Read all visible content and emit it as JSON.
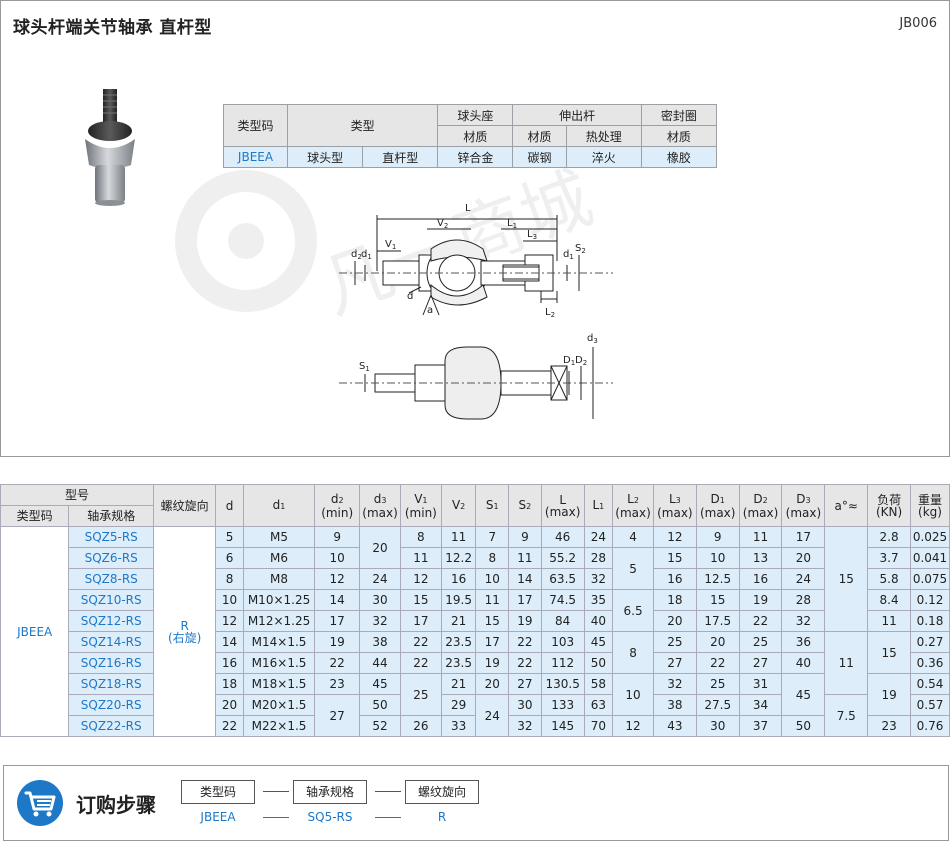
{
  "title": "球头杆端关节轴承  直杆型",
  "doc_code": "JB006",
  "spec": {
    "h_type_code": "类型码",
    "h_type": "类型",
    "h_ball_seat": "球头座",
    "h_rod": "伸出杆",
    "h_seal": "密封圈",
    "h_material": "材质",
    "h_heat": "热处理",
    "v_code": "JBEEA",
    "v_type1": "球头型",
    "v_type2": "直杆型",
    "v_seat": "锌合金",
    "v_rod": "碳钢",
    "v_heat": "淬火",
    "v_seal": "橡胶"
  },
  "drawing": {
    "L": "L",
    "L1": "L",
    "L3": "L",
    "L2": "L",
    "V1": "V",
    "V2": "V",
    "d2": "d",
    "d1": "d",
    "d": "d",
    "a": "a",
    "S2": "S",
    "S1": "S",
    "D1": "D",
    "D2": "D",
    "D3": "D",
    "d3": "d",
    "sub1": "1",
    "sub2": "2",
    "sub3": "3"
  },
  "table": {
    "h_model": "型号",
    "h_type_code": "类型码",
    "h_bearing": "轴承规格",
    "h_thread": "螺纹旋向",
    "h_d": "d",
    "h_d1": "d",
    "h_d2": "d",
    "h_d3": "d",
    "h_V1": "V",
    "h_V2": "V",
    "h_S1": "S",
    "h_S2": "S",
    "h_L": "L",
    "h_L1": "L",
    "h_L2": "L",
    "h_L3": "L",
    "h_D1": "D",
    "h_D2": "D",
    "h_D3": "D",
    "h_a": "a°≈",
    "h_load": "负荷",
    "h_load_unit": "(KN)",
    "h_weight": "重量",
    "h_weight_unit": "(kg)",
    "min": "(min)",
    "max": "(max)",
    "sub1": "1",
    "sub2": "2",
    "sub3": "3",
    "code": "JBEEA",
    "thread": "R",
    "thread_note": "(右旋)",
    "rows": [
      {
        "spec": "SQZ5-RS",
        "d": "5",
        "d1": "M5",
        "d2": "9",
        "V1": "8",
        "V2": "11",
        "S1": "7",
        "S2": "9",
        "L": "46",
        "L1": "24",
        "L3": "12",
        "D1": "9",
        "D2": "11",
        "D3": "17",
        "W": "0.025"
      },
      {
        "spec": "SQZ6-RS",
        "d": "6",
        "d1": "M6",
        "d2": "10",
        "V1": "11",
        "V2": "12.2",
        "S1": "8",
        "S2": "11",
        "L": "55.2",
        "L1": "28",
        "L3": "15",
        "D1": "10",
        "D2": "13",
        "D3": "20",
        "W": "0.041"
      },
      {
        "spec": "SQZ8-RS",
        "d": "8",
        "d1": "M8",
        "d2": "12",
        "V1": "12",
        "V2": "16",
        "S1": "10",
        "S2": "14",
        "L": "63.5",
        "L1": "32",
        "L3": "16",
        "D1": "12.5",
        "D2": "16",
        "D3": "24",
        "W": "0.075"
      },
      {
        "spec": "SQZ10-RS",
        "d": "10",
        "d1": "M10×1.25",
        "d2": "14",
        "V1": "15",
        "V2": "19.5",
        "S1": "11",
        "S2": "17",
        "L": "74.5",
        "L1": "35",
        "L3": "18",
        "D1": "15",
        "D2": "19",
        "D3": "28",
        "W": "0.12"
      },
      {
        "spec": "SQZ12-RS",
        "d": "12",
        "d1": "M12×1.25",
        "d2": "17",
        "V1": "17",
        "V2": "21",
        "S1": "15",
        "S2": "19",
        "L": "84",
        "L1": "40",
        "L3": "20",
        "D1": "17.5",
        "D2": "22",
        "D3": "32",
        "W": "0.18"
      },
      {
        "spec": "SQZ14-RS",
        "d": "14",
        "d1": "M14×1.5",
        "d2": "19",
        "V1": "22",
        "V2": "23.5",
        "S1": "17",
        "S2": "22",
        "L": "103",
        "L1": "45",
        "L3": "25",
        "D1": "20",
        "D2": "25",
        "D3": "36",
        "W": "0.27"
      },
      {
        "spec": "SQZ16-RS",
        "d": "16",
        "d1": "M16×1.5",
        "d2": "22",
        "V1": "22",
        "V2": "23.5",
        "S1": "19",
        "S2": "22",
        "L": "112",
        "L1": "50",
        "L3": "27",
        "D1": "22",
        "D2": "27",
        "D3": "40",
        "W": "0.36"
      },
      {
        "spec": "SQZ18-RS",
        "d": "18",
        "d1": "M18×1.5",
        "d2": "23",
        "V2": "21",
        "S1": "20",
        "S2": "27",
        "L": "130.5",
        "L1": "58",
        "L3": "32",
        "D1": "25",
        "D2": "31",
        "W": "0.54"
      },
      {
        "spec": "SQZ20-RS",
        "d": "20",
        "d1": "M20×1.5",
        "V2": "29",
        "S2": "30",
        "L": "133",
        "L1": "63",
        "L3": "38",
        "D1": "27.5",
        "D2": "34",
        "W": "0.57"
      },
      {
        "spec": "SQZ22-RS",
        "d": "22",
        "d1": "M22×1.5",
        "V1": "26",
        "V2": "33",
        "S2": "32",
        "L": "145",
        "L1": "70",
        "L3": "43",
        "D1": "30",
        "D2": "37",
        "D3": "50",
        "W": "0.76"
      }
    ],
    "merged": {
      "d3_20": "20",
      "d3_24": "24",
      "d3_30": "30",
      "d3_32": "32",
      "d3_38": "38",
      "d3_44": "44",
      "d3_45": "45",
      "d3_50": "50",
      "d3_52": "52",
      "d2_27": "27",
      "V1_25": "25",
      "S1_24": "24",
      "L2_4": "4",
      "L2_5": "5",
      "L2_65": "6.5",
      "L2_8": "8",
      "L2_10": "10",
      "L2_12": "12",
      "D3_45": "45",
      "a_15": "15",
      "a_11": "11",
      "a_75": "7.5",
      "load_28": "2.8",
      "load_37": "3.7",
      "load_58": "5.8",
      "load_84": "8.4",
      "load_11": "11",
      "load_15": "15",
      "load_19": "19",
      "load_23": "23"
    }
  },
  "order": {
    "title": "订购步骤",
    "step1": "类型码",
    "step2": "轴承规格",
    "step3": "螺纹旋向",
    "val1": "JBEEA",
    "val2": "SQ5-RS",
    "val3": "R"
  }
}
